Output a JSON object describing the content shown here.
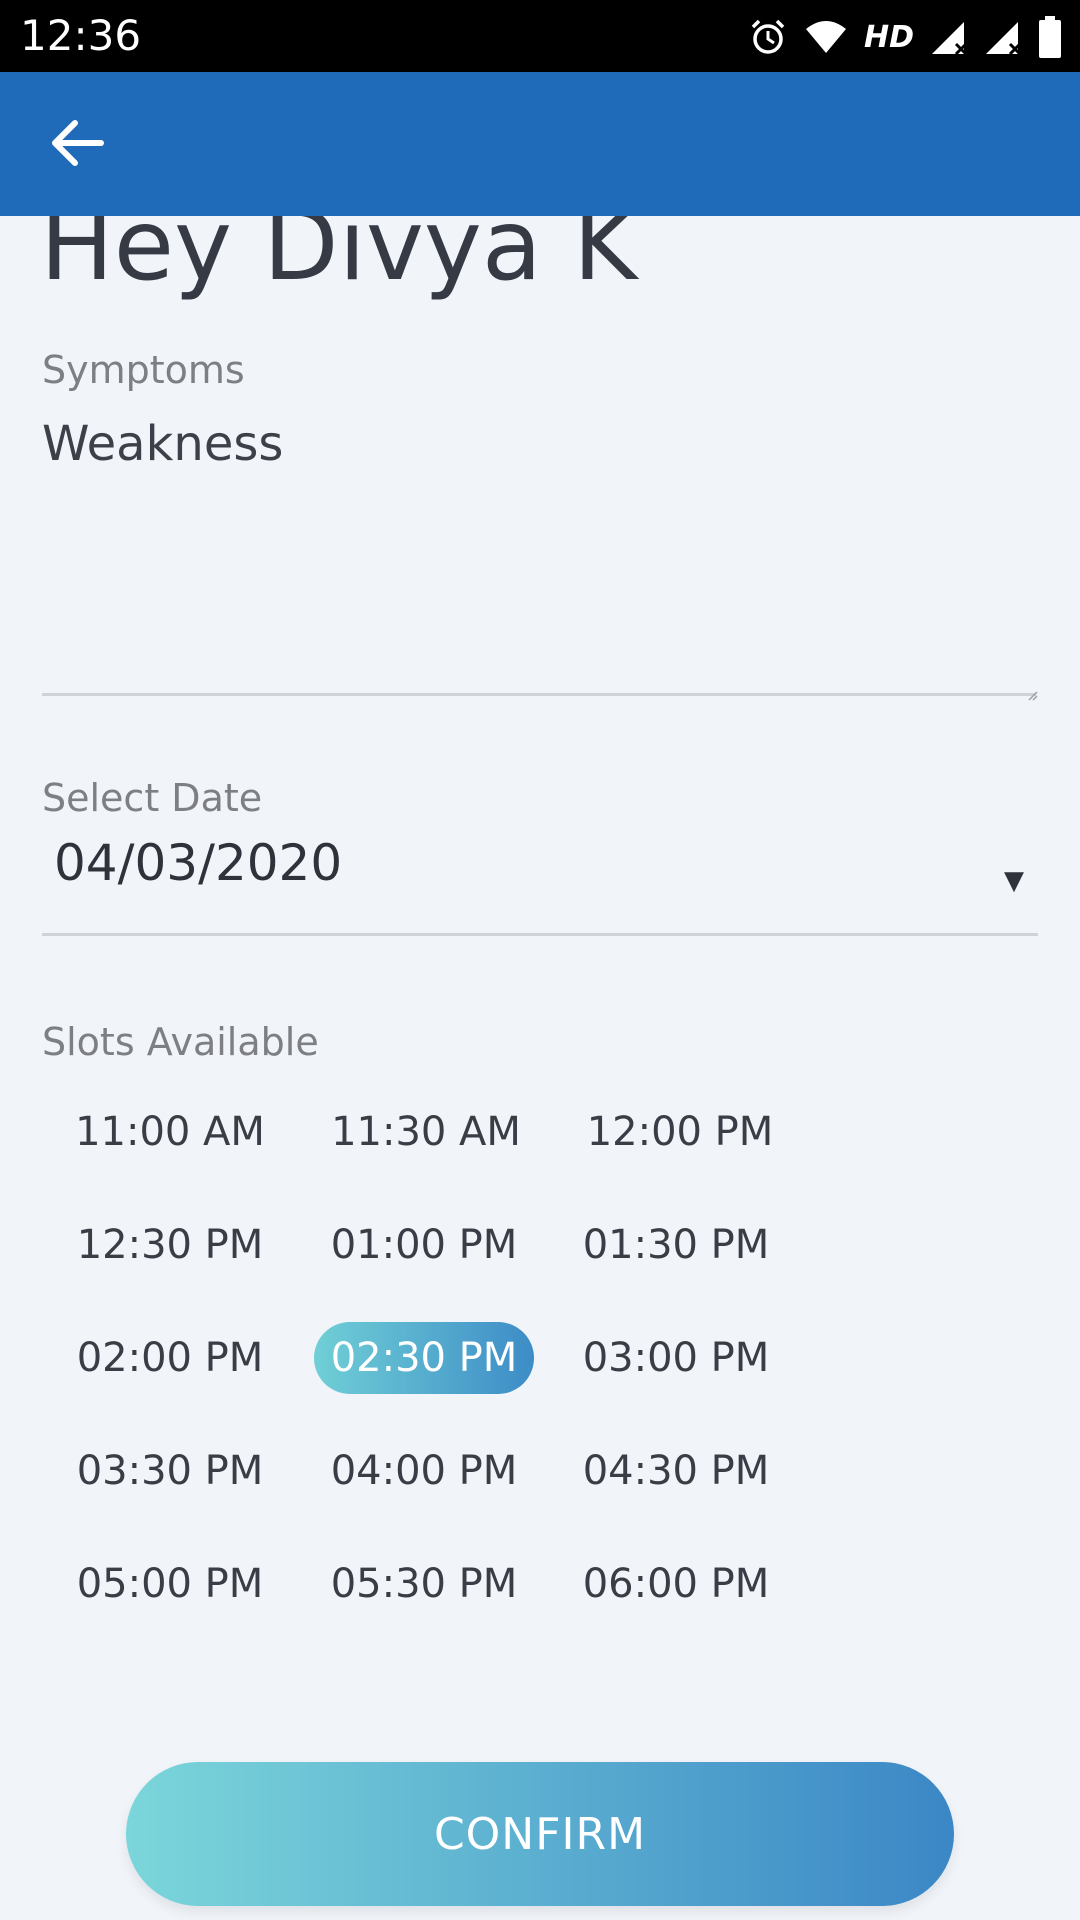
{
  "status_bar": {
    "time": "12:36",
    "network_label": "HD",
    "icons": [
      "alarm-icon",
      "wifi-icon",
      "signal-icon",
      "signal-icon",
      "battery-icon"
    ]
  },
  "app_bar": {
    "back_icon": "arrow-left-icon",
    "color": "#1f6bba"
  },
  "greeting": "Hey Divya K",
  "symptoms": {
    "label": "Symptoms",
    "value": "Weakness"
  },
  "date": {
    "label": "Select Date",
    "value": "04/03/2020",
    "caret": "▼"
  },
  "slots": {
    "label": "Slots Available",
    "times": [
      "11:00 AM",
      "11:30 AM",
      "12:00 PM",
      "12:30 PM",
      "01:00 PM",
      "01:30 PM",
      "02:00 PM",
      "02:30 PM",
      "03:00 PM",
      "03:30 PM",
      "04:00 PM",
      "04:30 PM",
      "05:00 PM",
      "05:30 PM",
      "06:00 PM"
    ],
    "selected": "02:30 PM",
    "accent_gradient": [
      "#70cfd6",
      "#3d8cc7"
    ]
  },
  "confirm": {
    "label": "CONFIRM"
  }
}
